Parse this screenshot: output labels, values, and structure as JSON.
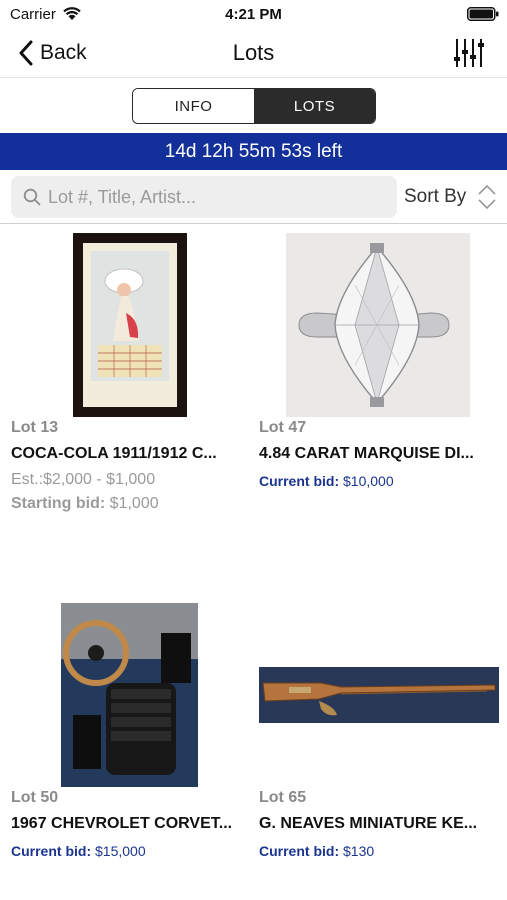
{
  "status_bar": {
    "carrier": "Carrier",
    "time": "4:21 PM"
  },
  "nav": {
    "back_label": "Back",
    "title": "Lots"
  },
  "segments": {
    "info": "INFO",
    "lots": "LOTS",
    "selected": "LOTS"
  },
  "timer": {
    "text": "14d 12h 55m 53s left"
  },
  "search": {
    "placeholder": "Lot #, Title, Artist...",
    "value": ""
  },
  "sort": {
    "label": "Sort By"
  },
  "colors": {
    "timer_bg": "#13309a",
    "current_bid": "#1a3590",
    "segment_selected": "#2b2b2b"
  },
  "lots": [
    {
      "lot": "Lot 13",
      "title": "COCA-COLA 1911/1912 C...",
      "estimate": "Est.:$2,000 - $1,000",
      "starting_label": "Starting bid:",
      "starting_value": "$1,000"
    },
    {
      "lot": "Lot 47",
      "title": "4.84 CARAT MARQUISE DI...",
      "bid_label": "Current bid:",
      "bid_value": "$10,000"
    },
    {
      "lot": "Lot 50",
      "title": "1967 CHEVROLET CORVET...",
      "bid_label": "Current bid:",
      "bid_value": "$15,000"
    },
    {
      "lot": "Lot 65",
      "title": "G. NEAVES MINIATURE KE...",
      "bid_label": "Current bid:",
      "bid_value": "$130"
    }
  ]
}
